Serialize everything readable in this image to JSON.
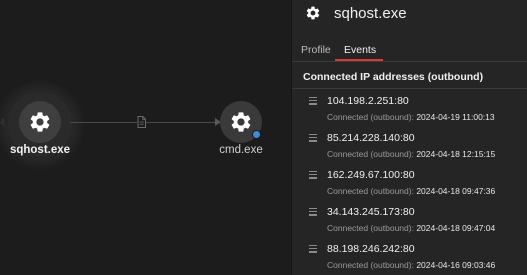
{
  "graph": {
    "primary_node": {
      "label": "sqhost.exe",
      "icon": "gear-icon"
    },
    "secondary_node": {
      "label": "cmd.exe",
      "icon": "gear-icon",
      "status_color": "#3b8bd9"
    },
    "edge_icon": "document-icon"
  },
  "panel": {
    "title": "sqhost.exe",
    "icon": "gear-icon",
    "tabs": [
      {
        "label": "Profile",
        "active": false
      },
      {
        "label": "Events",
        "active": true
      }
    ],
    "accent_color": "#d63a3a",
    "section_title": "Connected IP addresses (outbound)",
    "events": [
      {
        "ip": "104.198.2.251:80",
        "label": "Connected (outbound):",
        "timestamp": "2024-04-19 11:00:13"
      },
      {
        "ip": "85.214.228.140:80",
        "label": "Connected (outbound):",
        "timestamp": "2024-04-18 12:15:15"
      },
      {
        "ip": "162.249.67.100:80",
        "label": "Connected (outbound):",
        "timestamp": "2024-04-18 09:47:36"
      },
      {
        "ip": "34.143.245.173:80",
        "label": "Connected (outbound):",
        "timestamp": "2024-04-18 09:47:04"
      },
      {
        "ip": "88.198.246.242:80",
        "label": "Connected (outbound):",
        "timestamp": "2024-04-16 09:03:46"
      }
    ]
  }
}
